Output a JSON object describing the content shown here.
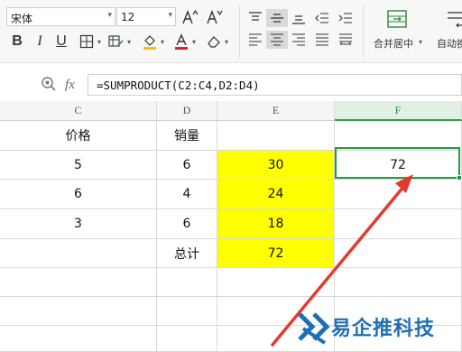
{
  "toolbar": {
    "font_name": "宋体",
    "font_size": "12",
    "merge_label": "合并居中",
    "autowrap_label": "自动换"
  },
  "formula_bar": {
    "fx_label": "fx",
    "formula": "=SUMPRODUCT(C2:C4,D2:D4)"
  },
  "columns": [
    "C",
    "D",
    "E",
    "F"
  ],
  "active_column": "F",
  "rows": [
    {
      "c": "价格",
      "d": "销量",
      "e": "",
      "f": ""
    },
    {
      "c": "5",
      "d": "6",
      "e": "30",
      "f": "72"
    },
    {
      "c": "6",
      "d": "4",
      "e": "24",
      "f": ""
    },
    {
      "c": "3",
      "d": "6",
      "e": "18",
      "f": ""
    },
    {
      "c": "",
      "d": "总计",
      "e": "72",
      "f": ""
    }
  ],
  "highlight_color": "#ffff00",
  "selection_color": "#1e9e3e",
  "annotation_arrow_color": "#e23b2e",
  "watermark": {
    "text": "易企推科技",
    "color": "#1f6fb7"
  }
}
